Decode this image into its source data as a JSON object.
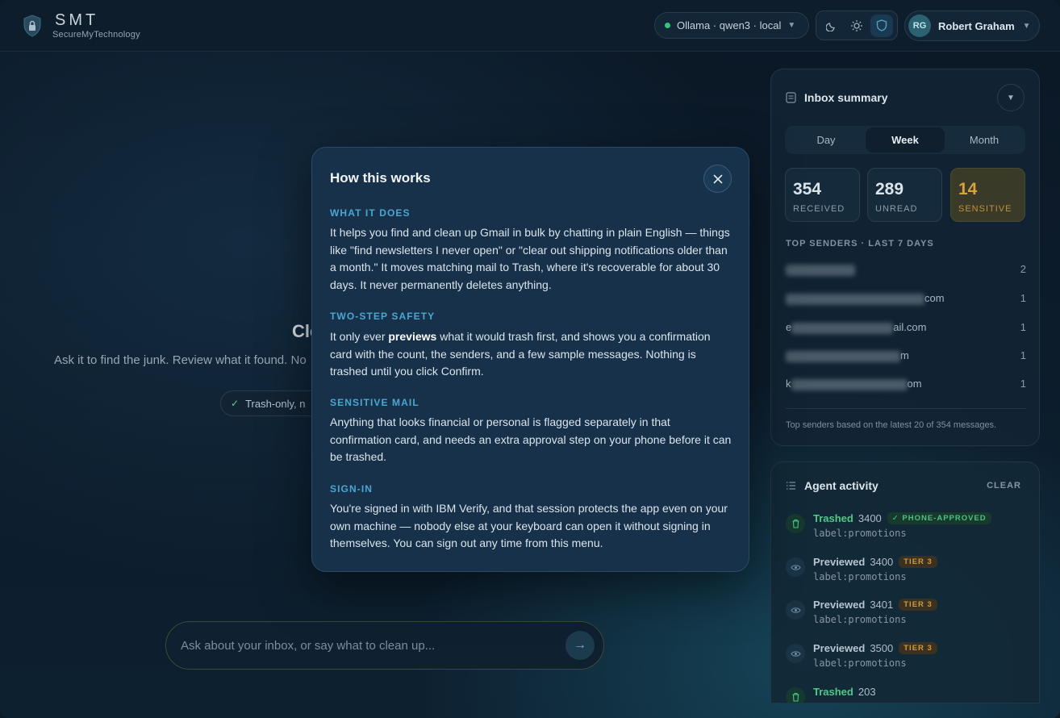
{
  "header": {
    "brand": "SMT",
    "brand_sub": "SecureMyTechnology",
    "model": "Ollama · qwen3 · local",
    "user_initials": "RG",
    "user_name": "Robert Graham"
  },
  "main": {
    "hero_title": "Cle",
    "hero_sub": "Ask it to find the junk. Review what it found. No",
    "trash_chip": "Trash-only, n",
    "input_placeholder": "Ask about your inbox, or say what to clean up..."
  },
  "summary": {
    "title": "Inbox summary",
    "tabs": [
      {
        "label": "Day",
        "active": false
      },
      {
        "label": "Week",
        "active": true
      },
      {
        "label": "Month",
        "active": false
      }
    ],
    "stats": [
      {
        "value": "354",
        "label": "RECEIVED"
      },
      {
        "value": "289",
        "label": "UNREAD"
      },
      {
        "value": "14",
        "label": "SENSITIVE"
      }
    ],
    "senders_heading": "TOP SENDERS · LAST 7 DAYS",
    "senders": [
      {
        "prefix": "",
        "suffix": "",
        "count": "2"
      },
      {
        "prefix": "",
        "suffix": "com",
        "count": "1"
      },
      {
        "prefix": "e",
        "suffix": "ail.com",
        "count": "1"
      },
      {
        "prefix": "",
        "suffix": "m",
        "count": "1"
      },
      {
        "prefix": "k",
        "suffix": "om",
        "count": "1"
      }
    ],
    "footer": "Top senders based on the latest 20 of 354 messages."
  },
  "activity": {
    "title": "Agent activity",
    "clear_label": "CLEAR",
    "items": [
      {
        "verb": "Trashed",
        "kind": "trashed",
        "count": "3400",
        "badge": "✓ PHONE-APPROVED",
        "badge_kind": "phone",
        "query": "label:promotions"
      },
      {
        "verb": "Previewed",
        "kind": "previewed",
        "count": "3400",
        "badge": "TIER 3",
        "badge_kind": "tier",
        "query": "label:promotions"
      },
      {
        "verb": "Previewed",
        "kind": "previewed",
        "count": "3401",
        "badge": "TIER 3",
        "badge_kind": "tier",
        "query": "label:promotions"
      },
      {
        "verb": "Previewed",
        "kind": "previewed",
        "count": "3500",
        "badge": "TIER 3",
        "badge_kind": "tier",
        "query": "label:promotions"
      },
      {
        "verb": "Trashed",
        "kind": "trashed",
        "count": "203",
        "badge": "",
        "badge_kind": "",
        "query": ""
      }
    ]
  },
  "modal": {
    "title": "How this works",
    "sections": [
      {
        "heading": "WHAT IT DOES",
        "body": "It helps you find and clean up Gmail in bulk by chatting in plain English — things like \"find newsletters I never open\" or \"clear out shipping notifications older than a month.\" It moves matching mail to Trash, where it's recoverable for about 30 days. It never permanently deletes anything."
      },
      {
        "heading": "TWO-STEP SAFETY",
        "body_before": "It only ever ",
        "body_bold": "previews",
        "body_after": " what it would trash first, and shows you a confirmation card with the count, the senders, and a few sample messages. Nothing is trashed until you click Confirm."
      },
      {
        "heading": "SENSITIVE MAIL",
        "body": "Anything that looks financial or personal is flagged separately in that confirmation card, and needs an extra approval step on your phone before it can be trashed."
      },
      {
        "heading": "SIGN-IN",
        "body": "You're signed in with IBM Verify, and that session protects the app even on your own machine — nobody else at your keyboard can open it without signing in themselves. You can sign out any time from this menu."
      }
    ]
  },
  "colors": {
    "accent": "#4aa6d2",
    "success": "#4ec98a",
    "warning": "#d9a23d",
    "background": "#0c1a26"
  }
}
